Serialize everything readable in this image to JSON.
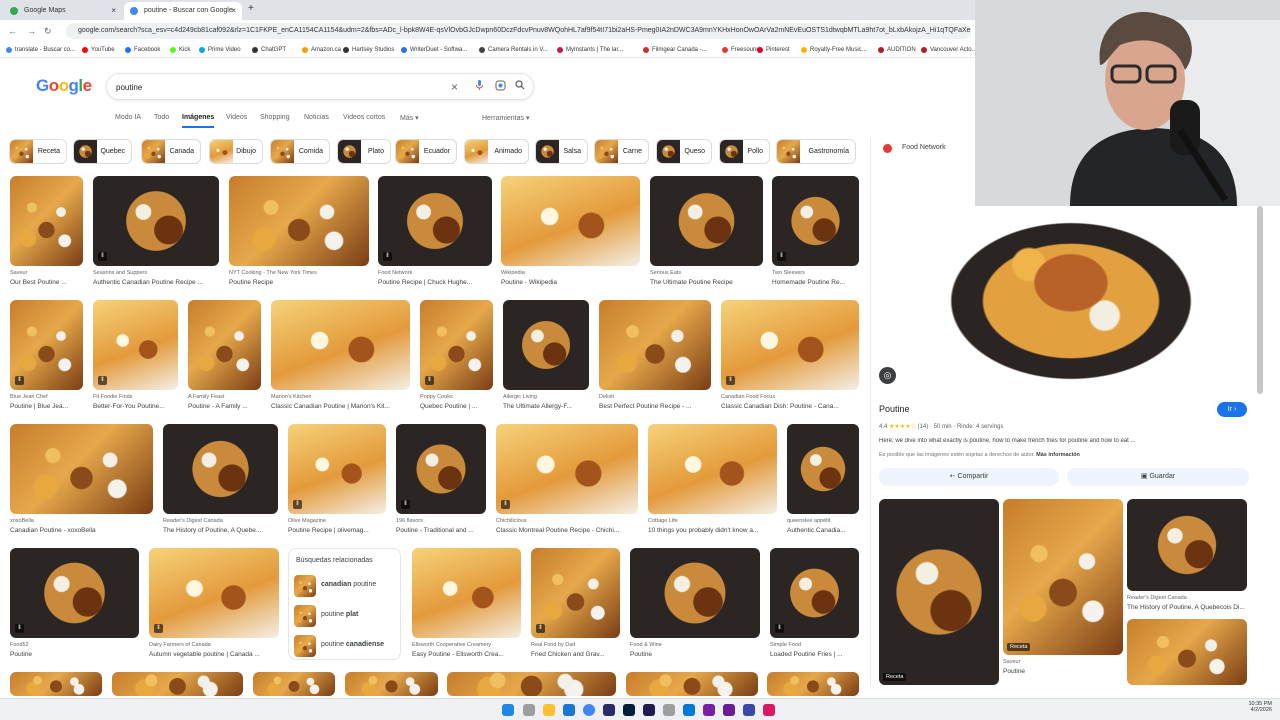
{
  "tabs": [
    {
      "label": "Google Maps",
      "color": "#34a853",
      "active": false
    },
    {
      "label": "poutine - Buscar con Google",
      "color": "#4285f4",
      "active": true
    }
  ],
  "new_tab": "+",
  "close": "×",
  "url": "google.com/search?sca_esv=c4d249cb81caf092&rlz=1C1FKPE_enCA1154CA1154&udm=2&fbs=ADc_l-bpk8W4E-qsVlOvbGJcDwpn60DczFdcvPnuv8WQohHL7af9f54tI71bi2aHS-Pmeg0IA2nDWC3A9mnYKHxHonOwOArVa2mNEvEuOSTS1dtwqbMTLa9ht7ot_bLxbAkojzA_Hi1qTQFaXeQfYvAsh",
  "bookmarks": [
    {
      "label": "translate - Buscar co...",
      "color": "#4285f4"
    },
    {
      "label": "YouTube",
      "color": "#ff0000"
    },
    {
      "label": "Facebook",
      "color": "#1877f2"
    },
    {
      "label": "Kick",
      "color": "#53fc18"
    },
    {
      "label": "Prime Video",
      "color": "#00a8e1"
    },
    {
      "label": "ChatGPT",
      "color": "#333333"
    },
    {
      "label": "Amazon.ca",
      "color": "#ff9900"
    },
    {
      "label": "Hartsey Studios",
      "color": "#333333"
    },
    {
      "label": "WriterDuet - Softwa...",
      "color": "#2a6fdb"
    },
    {
      "label": "Camera Rentals in V...",
      "color": "#444444"
    },
    {
      "label": "MyInstants | The lar...",
      "color": "#c2185b"
    },
    {
      "label": "Filmgear Canada -...",
      "color": "#d32f2f"
    },
    {
      "label": "Freesound",
      "color": "#e53935"
    },
    {
      "label": "Pinterest",
      "color": "#e60023"
    },
    {
      "label": "Royalty-Free Music...",
      "color": "#ffb300"
    },
    {
      "label": "AUDITION",
      "color": "#b71c1c"
    },
    {
      "label": "Vancouver Acto...",
      "color": "#b71c1c"
    }
  ],
  "logo": {
    "text": "Google",
    "letters": [
      "G",
      "o",
      "o",
      "g",
      "l",
      "e"
    ],
    "colors": [
      "#4285f4",
      "#ea4335",
      "#fbbc05",
      "#4285f4",
      "#34a853",
      "#ea4335"
    ]
  },
  "search": {
    "value": "poutine",
    "clear_icon": "×",
    "mic_icon": "mic-icon",
    "lens_icon": "lens-icon",
    "search_icon": "search-icon"
  },
  "nav": {
    "tabs": [
      "Modo IA",
      "Todo",
      "Imágenes",
      "Videos",
      "Shopping",
      "Noticias",
      "Videos cortos",
      "Más"
    ],
    "active": "Imágenes",
    "tools": "Herramientas"
  },
  "chips": [
    "Receta",
    "Quebec",
    "Canada",
    "Dibujo",
    "Comida",
    "Plato",
    "Ecuador",
    "Animado",
    "Salsa",
    "Carne",
    "Queso",
    "Pollo",
    "Gastronomía"
  ],
  "results": [
    {
      "src": "Saveur",
      "title": "Our Best Poutine ...",
      "style": "fri",
      "badge": false
    },
    {
      "src": "Seasons and Suppers",
      "title": "Authentic Canadian Poutine Recipe ...",
      "style": "dark",
      "badge": true
    },
    {
      "src": "NYT Cooking - The New York Times",
      "title": "Poutine Recipe",
      "style": "fri",
      "badge": false
    },
    {
      "src": "Food Network",
      "title": "Poutine Recipe | Chuck Hughe...",
      "style": "dark",
      "badge": true
    },
    {
      "src": "Wikipedia",
      "title": "Poutine - Wikipedia",
      "style": "light",
      "badge": false
    },
    {
      "src": "Serious Eats",
      "title": "The Ultimate Poutine Recipe",
      "style": "dark",
      "badge": false
    },
    {
      "src": "Two Sleevers",
      "title": "Homemade Poutine Re...",
      "style": "dark",
      "badge": true
    },
    {
      "src": "Blue Jean Chef",
      "title": "Poutine | Blue Jea...",
      "style": "fri",
      "badge": true
    },
    {
      "src": "Fit Foodie Finds",
      "title": "Better-For-You Poutine...",
      "style": "light",
      "badge": true
    },
    {
      "src": "A Family Feast",
      "title": "Poutine - A Family ...",
      "style": "fri",
      "badge": false
    },
    {
      "src": "Marion's Kitchen",
      "title": "Classic Canadian Poutine | Marion's Kit...",
      "style": "light",
      "badge": false
    },
    {
      "src": "Poppy Cooks",
      "title": "Quebec Poutine | ...",
      "style": "fri",
      "badge": true
    },
    {
      "src": "Allergic Living",
      "title": "The Ultimate Allergy-F...",
      "style": "dark",
      "badge": false
    },
    {
      "src": "Delish",
      "title": "Best Perfect Poutine Recipe - ...",
      "style": "fri",
      "badge": false
    },
    {
      "src": "Canadian Food Focus",
      "title": "Classic Canadian Dish: Poutine - Cana...",
      "style": "light",
      "badge": true
    },
    {
      "src": "xoxoBella",
      "title": "Canadian Poutine - xoxoBella",
      "style": "fri",
      "badge": false
    },
    {
      "src": "Reader's Digest Canada",
      "title": "The History of Poutine, A Quebe...",
      "style": "dark",
      "badge": false
    },
    {
      "src": "Olive Magazine",
      "title": "Poutine Recipe | olivemag...",
      "style": "light",
      "badge": true
    },
    {
      "src": "196 flavors",
      "title": "Poutine - Traditional and ...",
      "style": "dark",
      "badge": true
    },
    {
      "src": "Chichilicious",
      "title": "Classic Montreal Poutine Recipe - Chichi...",
      "style": "light",
      "badge": true
    },
    {
      "src": "Cottage Life",
      "title": "10 things you probably didn't know a...",
      "style": "light",
      "badge": false
    },
    {
      "src": "queenslee appétit",
      "title": "Authentic Canadia...",
      "style": "dark",
      "badge": false
    },
    {
      "src": "Food52",
      "title": "Poutine",
      "style": "dark",
      "badge": true
    },
    {
      "src": "Dairy Farmers of Canada",
      "title": "Autumn vegetable poutine | Canada ...",
      "style": "light",
      "badge": true
    },
    {
      "src": "Ellsworth Cooperative Creamery",
      "title": "Easy Poutine - Ellsworth Crea...",
      "style": "light",
      "badge": false
    },
    {
      "src": "Real Food by Dad",
      "title": "Fried Chicken and Grav...",
      "style": "fri",
      "badge": true
    },
    {
      "src": "Food & Wine",
      "title": "Poutine",
      "style": "dark",
      "badge": false
    },
    {
      "src": "Simple Food",
      "title": "Loaded Poutine Fries | ...",
      "style": "dark",
      "badge": true
    }
  ],
  "related": {
    "heading": "Búsquedas relacionadas",
    "items": [
      {
        "strong": "canadian",
        "rest": " poutine"
      },
      {
        "strong": "poutine",
        "rest": " plat"
      },
      {
        "strong": "poutine",
        "rest": " canadiense"
      }
    ]
  },
  "panel": {
    "source": "Food Network",
    "title": "Poutine",
    "visit": "Ir",
    "rating": "4.4",
    "stars": 4.4,
    "count": "(14)",
    "time": "50 min",
    "servings": "Rinde: 4 servings",
    "desc": "Here, we dive into what exactly is poutine, how to make french fries for poutine and how to eat ...",
    "copyright": "Es posible que las imágenes estén sujetas a derechos de autor.",
    "more_info": "Más información",
    "share": "Compartir",
    "save": "Guardar",
    "related": [
      {
        "src": "",
        "title": "",
        "badge": "Receta"
      },
      {
        "src": "Saveur",
        "title": "Poutine",
        "badge": "Receta"
      },
      {
        "src": "Reader's Digest Canada",
        "title": "The History of Poutine, A Quebecois Di...",
        "badge": ""
      }
    ]
  },
  "clock": {
    "time": "10:35 PM",
    "date": "4/2/2026"
  }
}
